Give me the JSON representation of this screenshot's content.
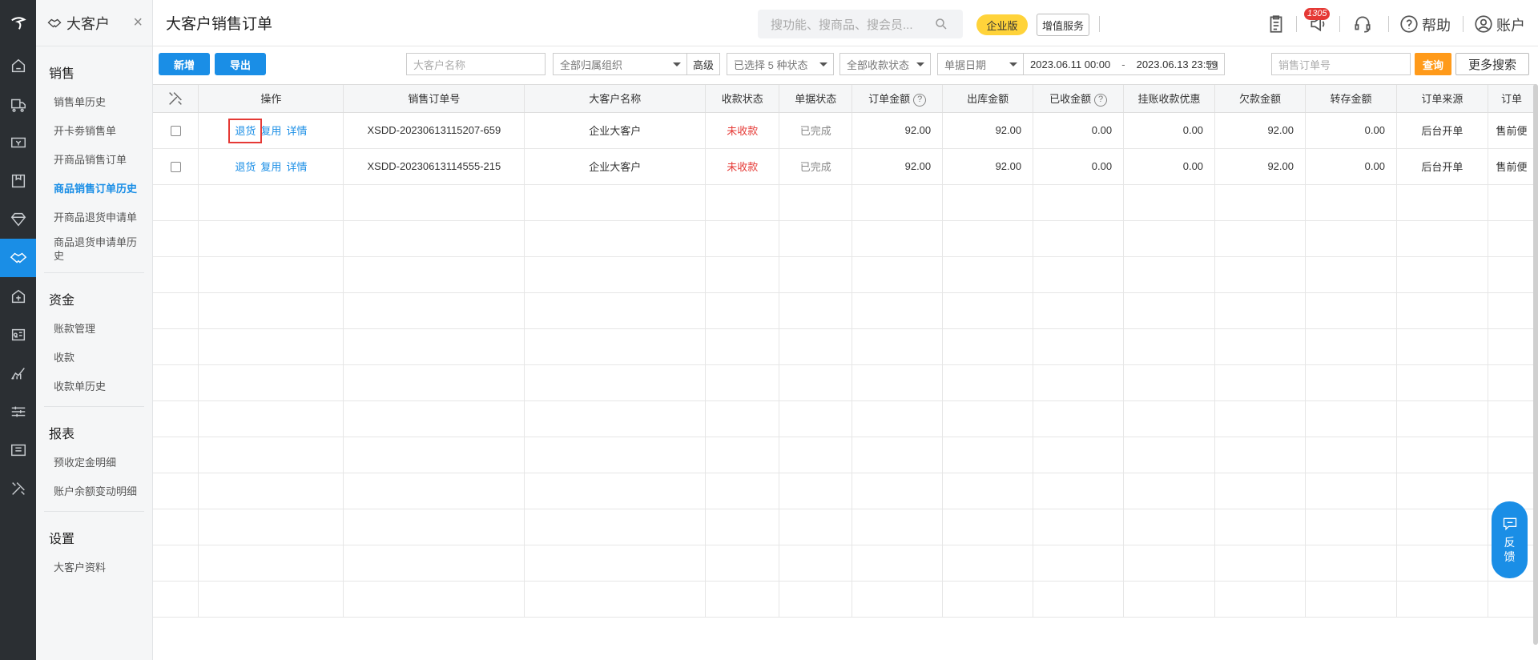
{
  "sidebar": {
    "title": "大客户",
    "close": "×",
    "sections": [
      {
        "label": "销售",
        "items": [
          "销售单历史",
          "开卡劵销售单",
          "开商品销售订单",
          "商品销售订单历史",
          "开商品退货申请单",
          "商品退货申请单历史"
        ]
      },
      {
        "label": "资金",
        "items": [
          "账款管理",
          "收款",
          "收款单历史"
        ]
      },
      {
        "label": "报表",
        "items": [
          "预收定金明细",
          "账户余额变动明细"
        ]
      },
      {
        "label": "设置",
        "items": [
          "大客户资料"
        ]
      }
    ]
  },
  "header": {
    "title": "大客户销售订单",
    "search_placeholder": "搜功能、搜商品、搜会员...",
    "edition": "企业版",
    "vas": "增值服务",
    "notif_count": "1305",
    "help": "帮助",
    "account": "账户"
  },
  "toolbar": {
    "add": "新增",
    "export": "导出",
    "customer_placeholder": "大客户名称",
    "org": "全部归属组织",
    "advanced": "高级",
    "status": "已选择 5 种状态",
    "pay_status": "全部收款状态",
    "date_type": "单据日期",
    "date_from": "2023.06.11 00:00",
    "date_sep": "-",
    "date_to": "2023.06.13 23:59",
    "order_placeholder": "销售订单号",
    "query": "查询",
    "more": "更多搜索"
  },
  "table": {
    "headers": [
      "操作",
      "销售订单号",
      "大客户名称",
      "收款状态",
      "单据状态",
      "订单金额",
      "出库金额",
      "已收金额",
      "挂账收款优惠",
      "欠款金额",
      "转存金额",
      "订单来源",
      "订单"
    ],
    "action_labels": [
      "退货",
      "复用",
      "详情"
    ],
    "rows": [
      {
        "order": "XSDD-20230613115207-659",
        "customer": "企业大客户",
        "pay_status": "未收款",
        "doc_status": "已完成",
        "amount": "92.00",
        "out": "92.00",
        "received": "0.00",
        "discount": "0.00",
        "owed": "92.00",
        "transfer": "0.00",
        "source": "后台开单",
        "type": "售前便"
      },
      {
        "order": "XSDD-20230613114555-215",
        "customer": "企业大客户",
        "pay_status": "未收款",
        "doc_status": "已完成",
        "amount": "92.00",
        "out": "92.00",
        "received": "0.00",
        "discount": "0.00",
        "owed": "92.00",
        "transfer": "0.00",
        "source": "后台开单",
        "type": "售前便"
      }
    ]
  },
  "feedback": "反馈",
  "colors": {
    "accent": "#1a8ee6",
    "query": "#ff9a1a",
    "edition": "#ffd33a",
    "alert": "#e53935"
  }
}
